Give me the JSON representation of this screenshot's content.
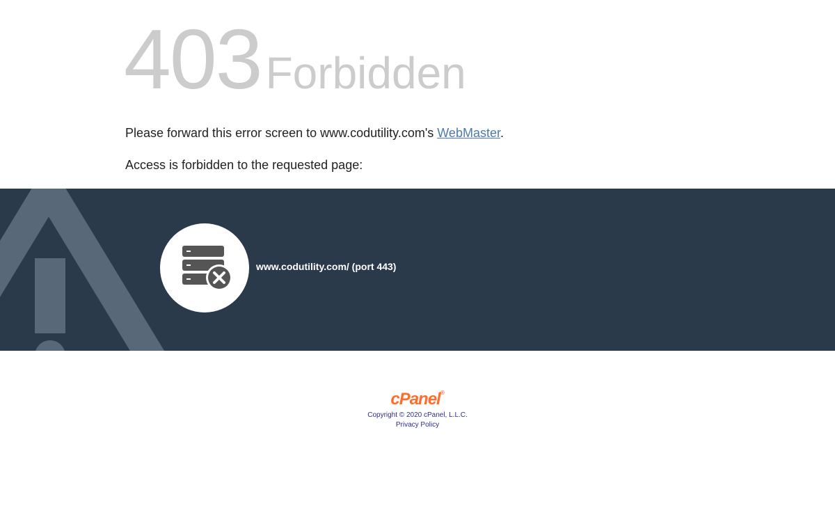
{
  "error": {
    "code": "403",
    "title": "Forbidden"
  },
  "message": {
    "prefix": "Please forward this error screen to www.codutility.com's ",
    "link_text": "WebMaster",
    "suffix": ".",
    "line2": "Access is forbidden to the requested page:"
  },
  "band": {
    "host": "www.codutility.com/ (port 443)",
    "icon": "server-error-icon",
    "background_icon": "warning-triangle-icon",
    "color": "#2b3a4b"
  },
  "footer": {
    "logo_text": "cPanel",
    "logo_mark": "®",
    "copyright": "Copyright © 2020 cPanel, L.L.C.",
    "privacy": "Privacy Policy",
    "logo_color": "#ff6c2c"
  }
}
